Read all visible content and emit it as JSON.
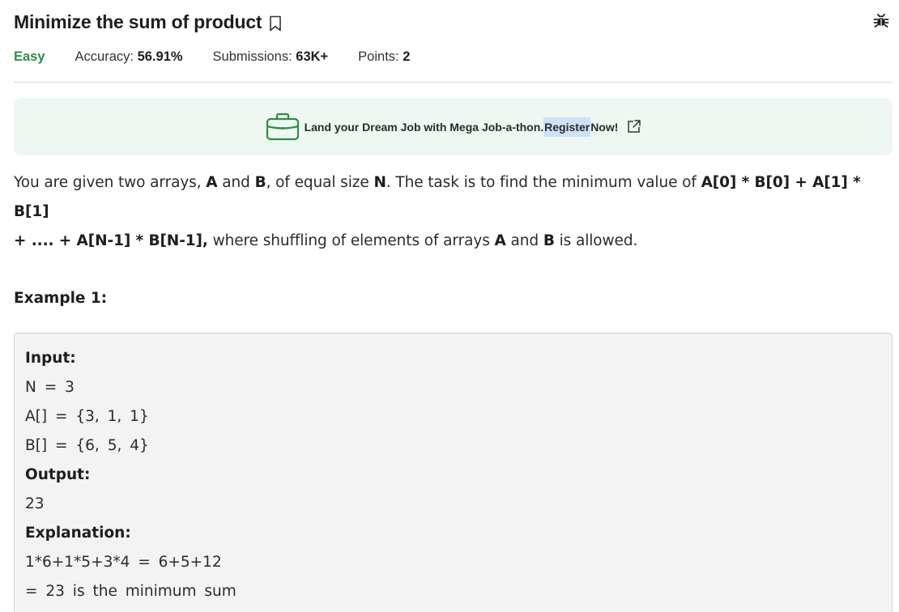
{
  "problem": {
    "title": "Minimize the sum of product",
    "difficulty": "Easy",
    "accuracy_label": "Accuracy: ",
    "accuracy_value": "56.91%",
    "submissions_label": "Submissions: ",
    "submissions_value": "63K+",
    "points_label": "Points: ",
    "points_value": "2"
  },
  "banner": {
    "text_before": "Land your Dream Job with Mega Job-a-thon. ",
    "highlight": "Register",
    "text_after": " Now!"
  },
  "description": {
    "t1": "You are given two arrays, ",
    "a": "A",
    "t2": " and ",
    "b": "B",
    "t3": ", of equal size ",
    "n": "N",
    "t4": ". The task is to find the minimum value of ",
    "formula1": "A[0] * B[0] + A[1] * B[1]",
    "formula2": "+ .... + A[N-1] * B[N-1],",
    "t5": " where shuffling of elements of arrays ",
    "a2": "A",
    "t6": " and ",
    "b2": "B",
    "t7": " is allowed."
  },
  "example": {
    "title": "Example 1:",
    "input_label": "Input:",
    "line_n": "N = 3",
    "line_a": "A[] = {3, 1, 1}",
    "line_b": "B[] = {6, 5, 4}",
    "output_label": "Output:",
    "output_value": "23",
    "explanation_label": "Explanation:",
    "explanation_1": "1*6+1*5+3*4 = 6+5+12",
    "explanation_2": "= 23 is the minimum sum"
  },
  "icons": {
    "bookmark": "bookmark-icon",
    "bug": "bug-icon",
    "briefcase": "briefcase-icon",
    "external": "external-link-icon"
  },
  "colors": {
    "difficulty_easy": "#2f8d46",
    "banner_bg": "#eef7f1",
    "briefcase": "#2f8d46",
    "highlight": "#cfe1f7",
    "example_bg": "#f3f3f3"
  }
}
